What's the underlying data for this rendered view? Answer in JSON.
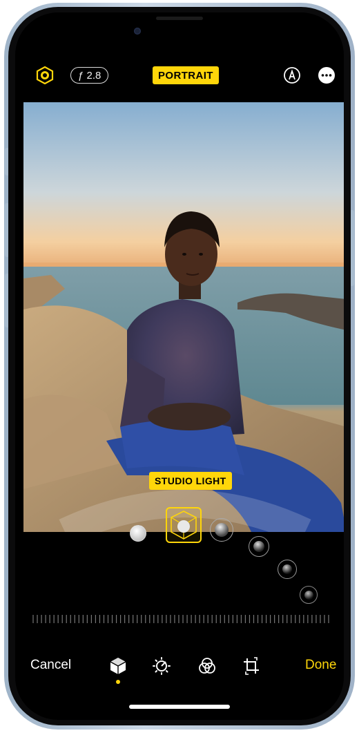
{
  "toolbar": {
    "aperture_label": "ƒ 2.8",
    "mode_label": "PORTRAIT",
    "accent_color": "#ffd60a"
  },
  "photo": {
    "lighting_label": "STUDIO LIGHT"
  },
  "lighting_options": [
    "natural-light",
    "studio-light",
    "contour-light",
    "stage-light",
    "stage-light-mono",
    "high-key-light-mono"
  ],
  "bottom": {
    "cancel_label": "Cancel",
    "done_label": "Done",
    "tools": [
      "portrait-lighting-icon",
      "adjust-icon",
      "filters-icon",
      "crop-icon"
    ],
    "selected_tool": "portrait-lighting-icon"
  }
}
